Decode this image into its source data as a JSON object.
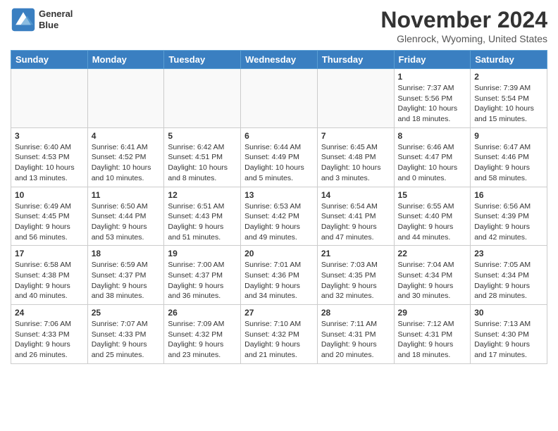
{
  "logo": {
    "line1": "General",
    "line2": "Blue"
  },
  "title": "November 2024",
  "location": "Glenrock, Wyoming, United States",
  "weekdays": [
    "Sunday",
    "Monday",
    "Tuesday",
    "Wednesday",
    "Thursday",
    "Friday",
    "Saturday"
  ],
  "weeks": [
    [
      {
        "day": "",
        "info": ""
      },
      {
        "day": "",
        "info": ""
      },
      {
        "day": "",
        "info": ""
      },
      {
        "day": "",
        "info": ""
      },
      {
        "day": "",
        "info": ""
      },
      {
        "day": "1",
        "info": "Sunrise: 7:37 AM\nSunset: 5:56 PM\nDaylight: 10 hours\nand 18 minutes."
      },
      {
        "day": "2",
        "info": "Sunrise: 7:39 AM\nSunset: 5:54 PM\nDaylight: 10 hours\nand 15 minutes."
      }
    ],
    [
      {
        "day": "3",
        "info": "Sunrise: 6:40 AM\nSunset: 4:53 PM\nDaylight: 10 hours\nand 13 minutes."
      },
      {
        "day": "4",
        "info": "Sunrise: 6:41 AM\nSunset: 4:52 PM\nDaylight: 10 hours\nand 10 minutes."
      },
      {
        "day": "5",
        "info": "Sunrise: 6:42 AM\nSunset: 4:51 PM\nDaylight: 10 hours\nand 8 minutes."
      },
      {
        "day": "6",
        "info": "Sunrise: 6:44 AM\nSunset: 4:49 PM\nDaylight: 10 hours\nand 5 minutes."
      },
      {
        "day": "7",
        "info": "Sunrise: 6:45 AM\nSunset: 4:48 PM\nDaylight: 10 hours\nand 3 minutes."
      },
      {
        "day": "8",
        "info": "Sunrise: 6:46 AM\nSunset: 4:47 PM\nDaylight: 10 hours\nand 0 minutes."
      },
      {
        "day": "9",
        "info": "Sunrise: 6:47 AM\nSunset: 4:46 PM\nDaylight: 9 hours\nand 58 minutes."
      }
    ],
    [
      {
        "day": "10",
        "info": "Sunrise: 6:49 AM\nSunset: 4:45 PM\nDaylight: 9 hours\nand 56 minutes."
      },
      {
        "day": "11",
        "info": "Sunrise: 6:50 AM\nSunset: 4:44 PM\nDaylight: 9 hours\nand 53 minutes."
      },
      {
        "day": "12",
        "info": "Sunrise: 6:51 AM\nSunset: 4:43 PM\nDaylight: 9 hours\nand 51 minutes."
      },
      {
        "day": "13",
        "info": "Sunrise: 6:53 AM\nSunset: 4:42 PM\nDaylight: 9 hours\nand 49 minutes."
      },
      {
        "day": "14",
        "info": "Sunrise: 6:54 AM\nSunset: 4:41 PM\nDaylight: 9 hours\nand 47 minutes."
      },
      {
        "day": "15",
        "info": "Sunrise: 6:55 AM\nSunset: 4:40 PM\nDaylight: 9 hours\nand 44 minutes."
      },
      {
        "day": "16",
        "info": "Sunrise: 6:56 AM\nSunset: 4:39 PM\nDaylight: 9 hours\nand 42 minutes."
      }
    ],
    [
      {
        "day": "17",
        "info": "Sunrise: 6:58 AM\nSunset: 4:38 PM\nDaylight: 9 hours\nand 40 minutes."
      },
      {
        "day": "18",
        "info": "Sunrise: 6:59 AM\nSunset: 4:37 PM\nDaylight: 9 hours\nand 38 minutes."
      },
      {
        "day": "19",
        "info": "Sunrise: 7:00 AM\nSunset: 4:37 PM\nDaylight: 9 hours\nand 36 minutes."
      },
      {
        "day": "20",
        "info": "Sunrise: 7:01 AM\nSunset: 4:36 PM\nDaylight: 9 hours\nand 34 minutes."
      },
      {
        "day": "21",
        "info": "Sunrise: 7:03 AM\nSunset: 4:35 PM\nDaylight: 9 hours\nand 32 minutes."
      },
      {
        "day": "22",
        "info": "Sunrise: 7:04 AM\nSunset: 4:34 PM\nDaylight: 9 hours\nand 30 minutes."
      },
      {
        "day": "23",
        "info": "Sunrise: 7:05 AM\nSunset: 4:34 PM\nDaylight: 9 hours\nand 28 minutes."
      }
    ],
    [
      {
        "day": "24",
        "info": "Sunrise: 7:06 AM\nSunset: 4:33 PM\nDaylight: 9 hours\nand 26 minutes."
      },
      {
        "day": "25",
        "info": "Sunrise: 7:07 AM\nSunset: 4:33 PM\nDaylight: 9 hours\nand 25 minutes."
      },
      {
        "day": "26",
        "info": "Sunrise: 7:09 AM\nSunset: 4:32 PM\nDaylight: 9 hours\nand 23 minutes."
      },
      {
        "day": "27",
        "info": "Sunrise: 7:10 AM\nSunset: 4:32 PM\nDaylight: 9 hours\nand 21 minutes."
      },
      {
        "day": "28",
        "info": "Sunrise: 7:11 AM\nSunset: 4:31 PM\nDaylight: 9 hours\nand 20 minutes."
      },
      {
        "day": "29",
        "info": "Sunrise: 7:12 AM\nSunset: 4:31 PM\nDaylight: 9 hours\nand 18 minutes."
      },
      {
        "day": "30",
        "info": "Sunrise: 7:13 AM\nSunset: 4:30 PM\nDaylight: 9 hours\nand 17 minutes."
      }
    ]
  ]
}
